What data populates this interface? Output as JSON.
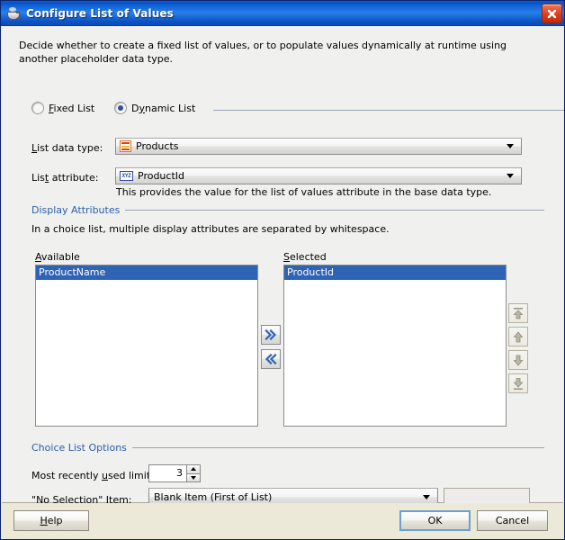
{
  "window": {
    "title": "Configure List of Values",
    "icon": "coffee-cup-icon",
    "close_label": "Close"
  },
  "intro": "Decide whether to create a fixed list of values, or to populate values dynamically at runtime using another placeholder data type.",
  "list_mode": {
    "fixed": {
      "label": "Fixed List",
      "selected": false
    },
    "dynamic": {
      "label": "Dynamic List",
      "selected": true
    }
  },
  "fields": {
    "data_type": {
      "label": "List data type:",
      "value": "Products",
      "icon": "table-icon"
    },
    "attribute": {
      "label": "List attribute:",
      "value": "ProductId",
      "icon": "xyz-attribute-icon",
      "hint": "This provides the value for the list of values attribute in the base data type."
    }
  },
  "display_attributes": {
    "section_title": "Display Attributes",
    "description": "In a choice list, multiple display attributes are separated by whitespace.",
    "available": {
      "label": "Available",
      "items": [
        "ProductName"
      ],
      "selected_index": 0
    },
    "selected": {
      "label": "Selected",
      "items": [
        "ProductId"
      ],
      "selected_index": 0
    },
    "transfer_buttons": [
      {
        "name": "add-button",
        "glyph": "»"
      },
      {
        "name": "remove-button",
        "glyph": "«"
      }
    ],
    "reorder_buttons": [
      {
        "name": "move-to-top-button",
        "glyph": "top"
      },
      {
        "name": "move-up-button",
        "glyph": "up"
      },
      {
        "name": "move-down-button",
        "glyph": "down"
      },
      {
        "name": "move-to-bottom-button",
        "glyph": "bottom"
      }
    ]
  },
  "choice_list_options": {
    "section_title": "Choice List Options",
    "mru_limit": {
      "label": "Most recently used limit:",
      "value": "3"
    },
    "no_selection": {
      "label": "\"No Selection\" Item:",
      "value": "Blank Item (First of List)",
      "extra_field_value": ""
    }
  },
  "footer": {
    "help": "Help",
    "ok": "OK",
    "cancel": "Cancel"
  },
  "colors": {
    "title_bar": "#0a51c5",
    "selection": "#2f63b5",
    "section_header": "#2b5faa",
    "close_button": "#c0290a"
  }
}
